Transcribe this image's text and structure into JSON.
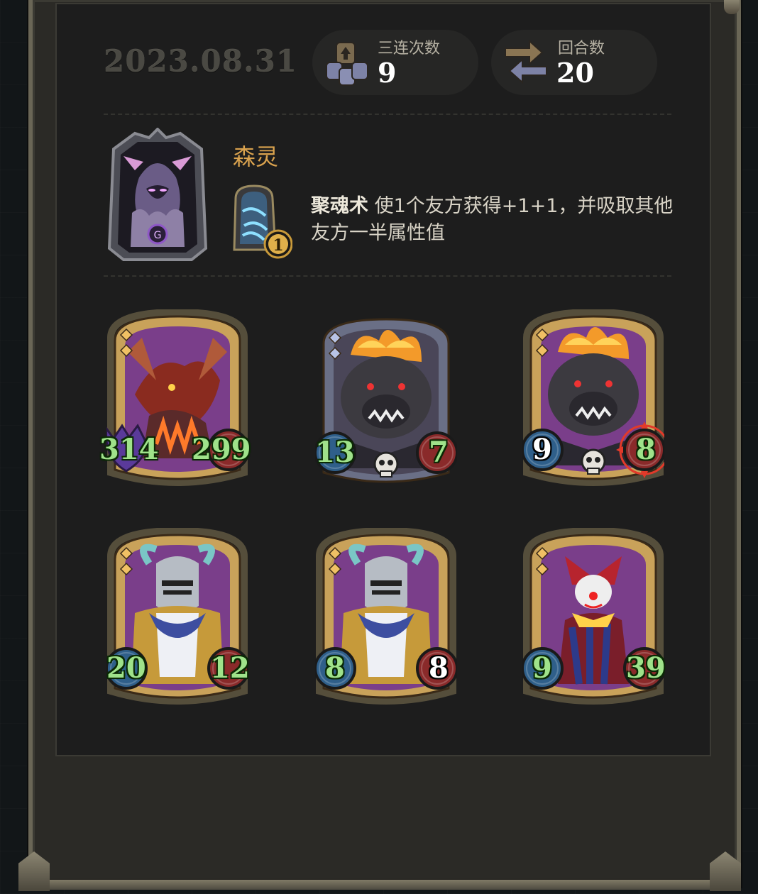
{
  "date": "2023.08.31",
  "stats": {
    "triple_label": "三连次数",
    "triple_value": "9",
    "round_label": "回合数",
    "round_value": "20"
  },
  "hero": {
    "name": "森灵",
    "spell_level": "1",
    "skill_name": "聚魂术",
    "skill_desc_line1": "使1个友方获得+1+1，并吸取其他",
    "skill_desc_line2": "友方一半属性值"
  },
  "units": [
    {
      "attack": "314",
      "health": "299",
      "tier": "gold",
      "art": "dragon",
      "attack_style": "horned",
      "health_style": "normal",
      "attack_color": "green",
      "health_color": "green"
    },
    {
      "attack": "13",
      "health": "7",
      "tier": "silver",
      "art": "boar",
      "attack_style": "normal",
      "health_style": "normal",
      "attack_color": "green",
      "health_color": "green",
      "skull": true
    },
    {
      "attack": "9",
      "health": "8",
      "tier": "gold",
      "art": "boar",
      "attack_style": "normal",
      "health_style": "target",
      "attack_color": "white",
      "health_color": "green",
      "skull": true
    },
    {
      "attack": "20",
      "health": "12",
      "tier": "gold",
      "art": "knight",
      "attack_style": "normal",
      "health_style": "normal",
      "attack_color": "green",
      "health_color": "green"
    },
    {
      "attack": "8",
      "health": "8",
      "tier": "gold",
      "art": "knight",
      "attack_style": "normal",
      "health_style": "normal",
      "attack_color": "green",
      "health_color": "white"
    },
    {
      "attack": "9",
      "health": "39",
      "tier": "gold",
      "art": "clown",
      "attack_style": "normal",
      "health_style": "normal",
      "attack_color": "green",
      "health_color": "green"
    }
  ],
  "colors": {
    "gold_frame": "#c9a25a",
    "silver_frame": "#6a6f86",
    "card_bg": "#7a3e8a",
    "stat_green": "#9fe28a",
    "hero_name": "#d9a24e"
  }
}
